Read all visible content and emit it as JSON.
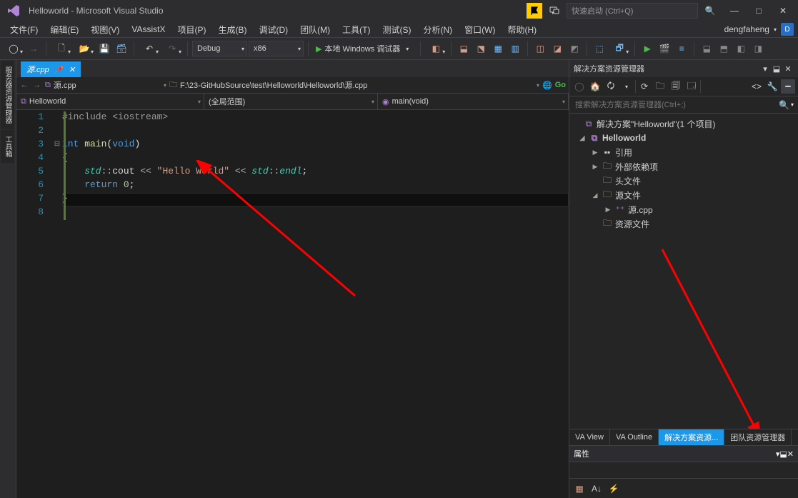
{
  "title": "Helloworld - Microsoft Visual Studio",
  "quick_launch_placeholder": "快速启动 (Ctrl+Q)",
  "user": {
    "name": "dengfaheng",
    "initial": "D"
  },
  "menu": [
    "文件(F)",
    "编辑(E)",
    "视图(V)",
    "VAssistX",
    "项目(P)",
    "生成(B)",
    "调试(D)",
    "团队(M)",
    "工具(T)",
    "测试(S)",
    "分析(N)",
    "窗口(W)",
    "帮助(H)"
  ],
  "config": "Debug",
  "platform": "x86",
  "run_label": "本地 Windows 调试器",
  "tab": {
    "name": "源.cpp"
  },
  "nav": {
    "file": "源.cpp",
    "path": "F:\\23-GitHubSource\\test\\Helloworld\\Helloworld\\源.cpp",
    "go": "Go"
  },
  "scope": {
    "project": "Helloworld",
    "func_scope": "(全局范围)",
    "member": "main(void)"
  },
  "lines": [
    "1",
    "2",
    "3",
    "4",
    "5",
    "6",
    "7",
    "8"
  ],
  "code": {
    "l1_a": "#include ",
    "l1_b": "<iostream>",
    "l3_a": "int",
    "l3_b": " main",
    "l3_c": "(",
    "l3_d": "void",
    "l3_e": ")",
    "l4": "{",
    "l5_a": "    std",
    "l5_b": "::",
    "l5_c": "cout ",
    "l5_d": "<< ",
    "l5_e": "\"Hello World\"",
    "l5_f": " << ",
    "l5_g": "std",
    "l5_h": "::",
    "l5_i": "endl",
    "l5_j": ";",
    "l6_a": "    return ",
    "l6_b": "0",
    "l6_c": ";",
    "l7": "}"
  },
  "solution_panel": {
    "title": "解决方案资源管理器",
    "search_placeholder": "搜索解决方案资源管理器(Ctrl+;)",
    "root": "解决方案\"Helloworld\"(1 个项目)",
    "project": "Helloworld",
    "refs": "引用",
    "external": "外部依赖项",
    "headers": "头文件",
    "sources": "源文件",
    "srcfile": "源.cpp",
    "resources": "资源文件"
  },
  "bottom_tabs": [
    "VA View",
    "VA Outline",
    "解决方案资源...",
    "团队资源管理器"
  ],
  "properties_title": "属性",
  "left_tabs": [
    "服务器资源管理器",
    "工具箱"
  ]
}
